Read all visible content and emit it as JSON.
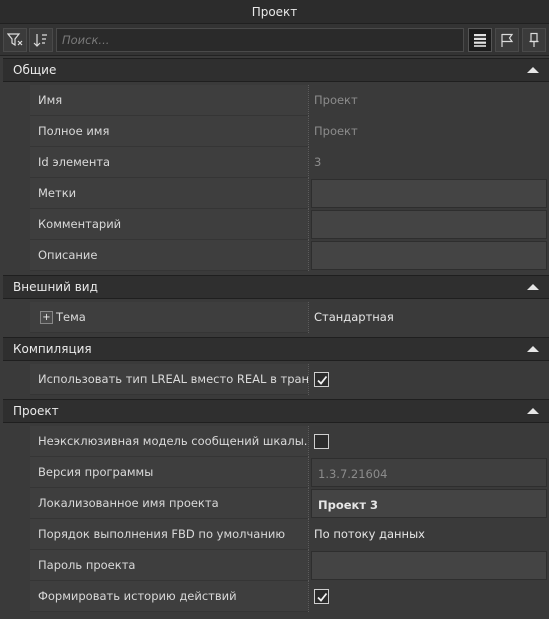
{
  "window": {
    "title": "Проект"
  },
  "toolbar": {
    "search_placeholder": "Поиск...",
    "filter_icon": "filter-icon",
    "sort_icon": "sort-icon",
    "list_view_icon": "list-view-icon",
    "flag_icon": "flag-icon",
    "pin_icon": "pin-icon"
  },
  "sections": {
    "general": {
      "label": "Общие",
      "rows": {
        "name": {
          "label": "Имя",
          "value": "Проект"
        },
        "full_name": {
          "label": "Полное имя",
          "value": "Проект"
        },
        "element_id": {
          "label": "Id элемента",
          "value": "3"
        },
        "tags": {
          "label": "Метки",
          "value": ""
        },
        "comment": {
          "label": "Комментарий",
          "value": ""
        },
        "description": {
          "label": "Описание",
          "value": ""
        }
      }
    },
    "appearance": {
      "label": "Внешний вид",
      "rows": {
        "theme": {
          "expander": "+",
          "label": "Тема",
          "value": "Стандартная"
        }
      }
    },
    "compilation": {
      "label": "Компиляция",
      "rows": {
        "use_lreal": {
          "label": "Использовать тип LREAL вместо REAL в транс...",
          "checked": true
        }
      }
    },
    "project": {
      "label": "Проект",
      "rows": {
        "nonexclusive": {
          "label": "Неэксклюзивная модель сообщений шкалы...",
          "checked": false
        },
        "program_version": {
          "label": "Версия программы",
          "value": "1.3.7.21604"
        },
        "localized_name": {
          "label": "Локализованное имя проекта",
          "value": "Проект 3"
        },
        "fbd_order": {
          "label": "Порядок выполнения FBD по умолчанию",
          "value": "По потоку данных"
        },
        "password": {
          "label": "Пароль проекта",
          "value": ""
        },
        "history": {
          "label": "Формировать историю действий",
          "checked": true
        }
      }
    }
  },
  "colors": {
    "background": "#3a3a3a",
    "section_header": "#2f2f2f",
    "row_name_bg": "#3e3e3e",
    "text": "#e6e6e6",
    "readonly_text": "#8c8c8c"
  }
}
